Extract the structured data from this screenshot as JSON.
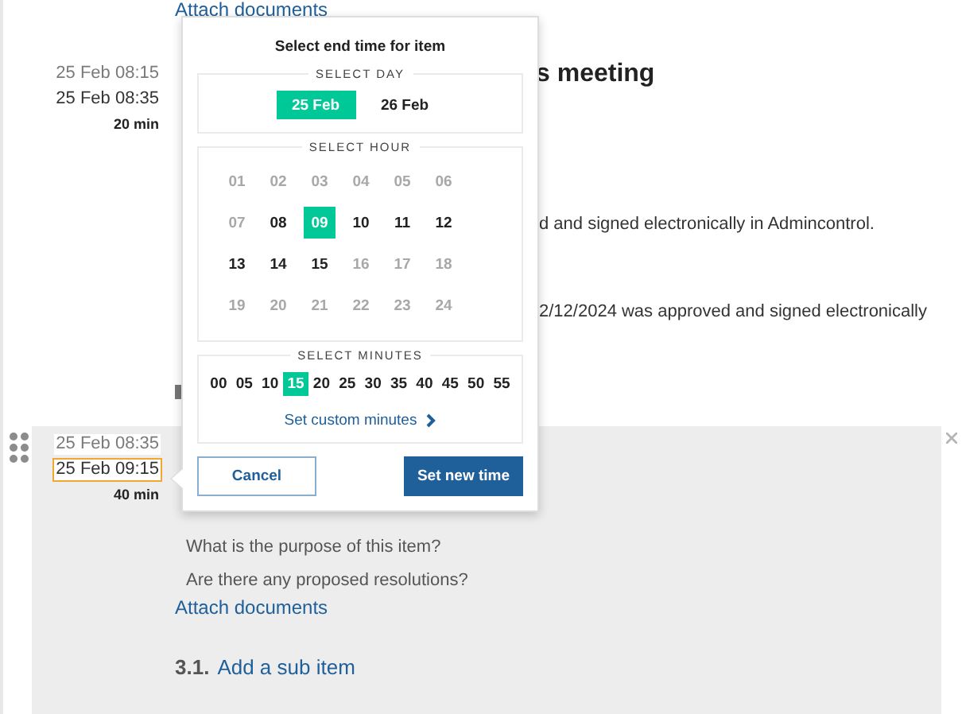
{
  "top_link": "Attach documents",
  "items": [
    {
      "start": "25 Feb 08:15",
      "end": "25 Feb 08:35",
      "duration": "20 min",
      "end_focused": false,
      "highlighted": false,
      "heading_tail": "s meeting",
      "blocks": [
        {
          "kind": "tail",
          "text": "d and signed electronically in Admincontrol."
        },
        {
          "kind": "tail",
          "text": "2/12/2024 was approved and signed electronically"
        },
        {
          "kind": "file_icon"
        }
      ]
    },
    {
      "start": "25 Feb 08:35",
      "end": "25 Feb 09:15",
      "duration": "40 min",
      "end_focused": true,
      "highlighted": true,
      "blocks": [
        {
          "kind": "question",
          "text": "What is the purpose of this item?"
        },
        {
          "kind": "question",
          "text": "Are there any proposed resolutions?"
        },
        {
          "kind": "link",
          "text": "Attach documents"
        }
      ],
      "sub_item": {
        "number": "3.1.",
        "label": "Add a sub item"
      }
    }
  ],
  "popover": {
    "title": "Select end time for item",
    "day_legend": "SELECT DAY",
    "days": [
      {
        "label": "25 Feb",
        "selected": true
      },
      {
        "label": "26 Feb",
        "selected": false
      }
    ],
    "hour_legend": "SELECT HOUR",
    "hours": [
      {
        "label": "01",
        "disabled": true,
        "selected": false
      },
      {
        "label": "02",
        "disabled": true,
        "selected": false
      },
      {
        "label": "03",
        "disabled": true,
        "selected": false
      },
      {
        "label": "04",
        "disabled": true,
        "selected": false
      },
      {
        "label": "05",
        "disabled": true,
        "selected": false
      },
      {
        "label": "06",
        "disabled": true,
        "selected": false
      },
      {
        "label": "07",
        "disabled": true,
        "selected": false
      },
      {
        "label": "08",
        "disabled": false,
        "selected": false
      },
      {
        "label": "09",
        "disabled": false,
        "selected": true
      },
      {
        "label": "10",
        "disabled": false,
        "selected": false
      },
      {
        "label": "11",
        "disabled": false,
        "selected": false
      },
      {
        "label": "12",
        "disabled": false,
        "selected": false
      },
      {
        "label": "13",
        "disabled": false,
        "selected": false
      },
      {
        "label": "14",
        "disabled": false,
        "selected": false
      },
      {
        "label": "15",
        "disabled": false,
        "selected": false
      },
      {
        "label": "16",
        "disabled": true,
        "selected": false
      },
      {
        "label": "17",
        "disabled": true,
        "selected": false
      },
      {
        "label": "18",
        "disabled": true,
        "selected": false
      },
      {
        "label": "19",
        "disabled": true,
        "selected": false
      },
      {
        "label": "20",
        "disabled": true,
        "selected": false
      },
      {
        "label": "21",
        "disabled": true,
        "selected": false
      },
      {
        "label": "22",
        "disabled": true,
        "selected": false
      },
      {
        "label": "23",
        "disabled": true,
        "selected": false
      },
      {
        "label": "24",
        "disabled": true,
        "selected": false
      }
    ],
    "minute_legend": "SELECT MINUTES",
    "minutes": [
      {
        "label": "00",
        "selected": false
      },
      {
        "label": "05",
        "selected": false
      },
      {
        "label": "10",
        "selected": false
      },
      {
        "label": "15",
        "selected": true
      },
      {
        "label": "20",
        "selected": false
      },
      {
        "label": "25",
        "selected": false
      },
      {
        "label": "30",
        "selected": false
      },
      {
        "label": "35",
        "selected": false
      },
      {
        "label": "40",
        "selected": false
      },
      {
        "label": "45",
        "selected": false
      },
      {
        "label": "50",
        "selected": false
      },
      {
        "label": "55",
        "selected": false
      }
    ],
    "custom_link": "Set custom minutes",
    "cancel": "Cancel",
    "confirm": "Set new time"
  }
}
